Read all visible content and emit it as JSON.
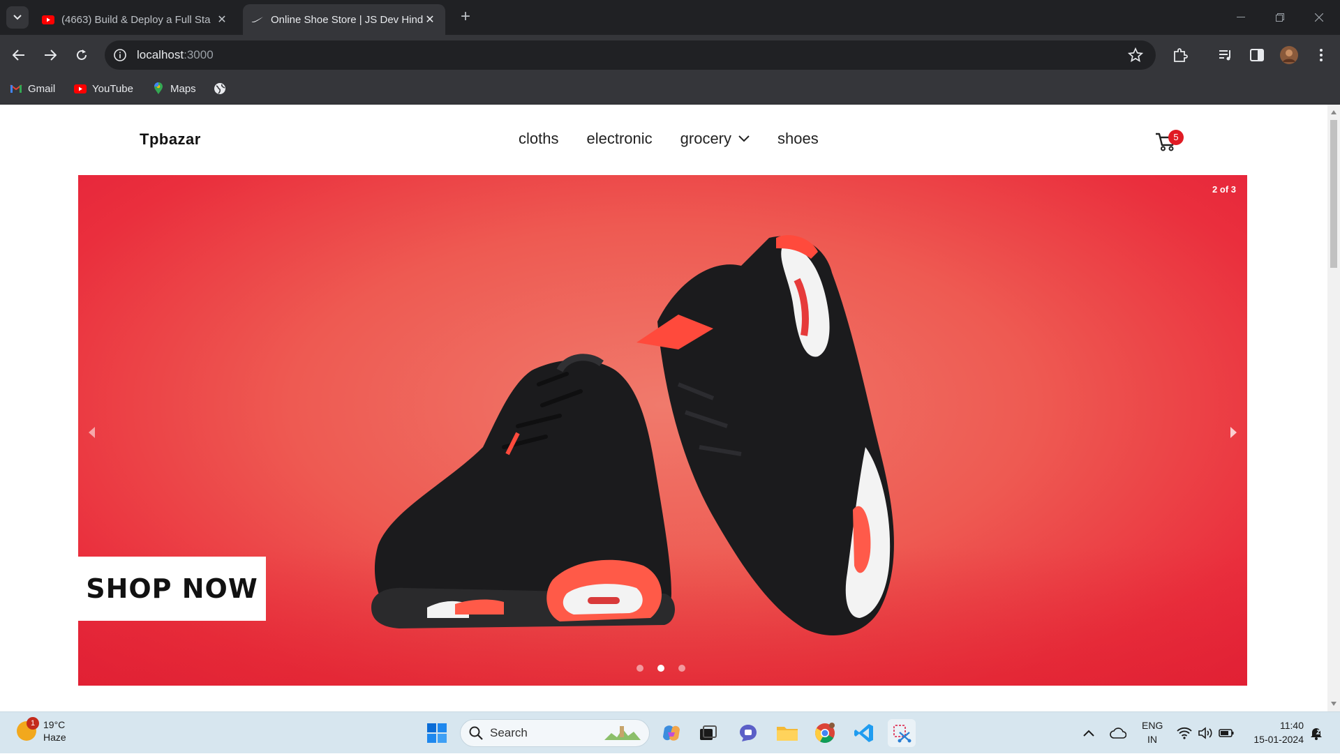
{
  "browser": {
    "tabs": [
      {
        "title": "(4663) Build & Deploy a Full Sta",
        "active": false,
        "icon": "youtube-icon"
      },
      {
        "title": "Online Shoe Store | JS Dev Hind",
        "active": true,
        "icon": "nike-swoosh-icon"
      }
    ],
    "url_host": "localhost",
    "url_port": ":3000",
    "bookmarks": [
      {
        "label": "Gmail",
        "icon": "gmail-icon"
      },
      {
        "label": "YouTube",
        "icon": "youtube-icon"
      },
      {
        "label": "Maps",
        "icon": "maps-icon"
      },
      {
        "label": "",
        "icon": "globe-icon"
      }
    ]
  },
  "site": {
    "brand": "Tpbazar",
    "nav": [
      "cloths",
      "electronic",
      "grocery",
      "shoes"
    ],
    "cart_count": "5",
    "hero": {
      "slide_counter": "2 of 3",
      "cta": "SHOP NOW",
      "active_slide": 2,
      "total_slides": 3
    }
  },
  "taskbar": {
    "weather_temp": "19°C",
    "weather_desc": "Haze",
    "weather_badge": "1",
    "search_label": "Search",
    "lang_top": "ENG",
    "lang_bottom": "IN",
    "time": "11:40",
    "date": "15-01-2024"
  },
  "colors": {
    "hero_red": "#ea2f3d",
    "cart_badge": "#e01b24",
    "chrome_dark": "#202124"
  }
}
